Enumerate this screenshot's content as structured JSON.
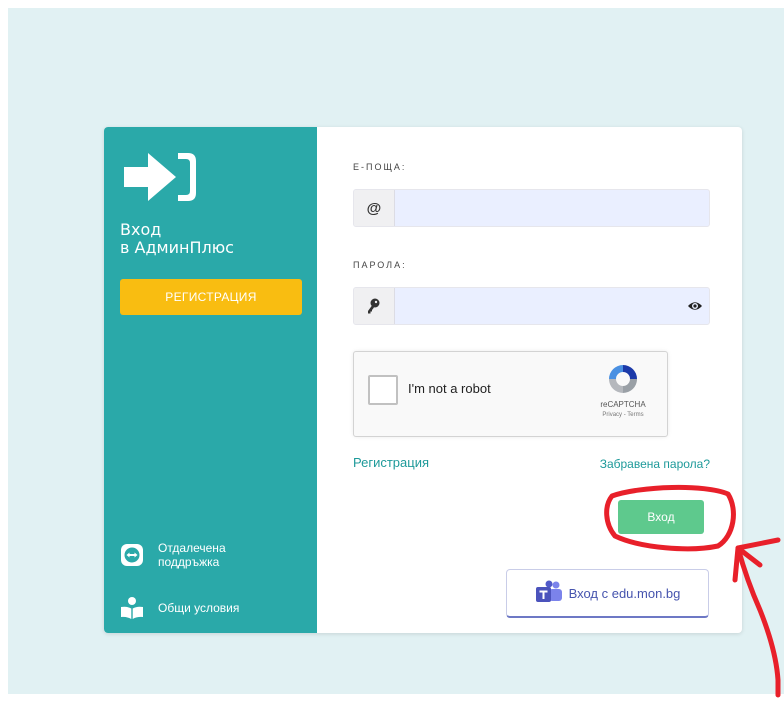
{
  "sidebar": {
    "title_line1": "Вход",
    "title_line2": "в АдминПлюс",
    "register_button": "РЕГИСТРАЦИЯ",
    "support_label_line1": "Отдалечена",
    "support_label_line2": "поддръжка",
    "terms_label": "Общи условия"
  },
  "form": {
    "email_label": "Е-ПОЩА:",
    "email_icon": "@",
    "email_value": "",
    "password_label": "ПАРОЛА:",
    "password_value": "",
    "captcha_text": "I'm not a robot",
    "captcha_brand": "reCAPTCHA",
    "captcha_terms": "Privacy - Terms",
    "register_link": "Регистрация",
    "forgot_link": "Забравена парола?",
    "login_button": "Вход",
    "edu_button": "Вход с edu.mon.bg"
  },
  "colors": {
    "page_bg": "#e1f1f3",
    "sidebar": "#2aa9a9",
    "register": "#f9bd11",
    "login": "#5ec98d",
    "annotation": "#e8202a"
  },
  "icons": [
    "sign-in-arrow-icon",
    "at-icon",
    "key-icon",
    "eye-icon",
    "recaptcha-icon",
    "remote-support-icon",
    "book-reader-icon",
    "teams-icon"
  ]
}
